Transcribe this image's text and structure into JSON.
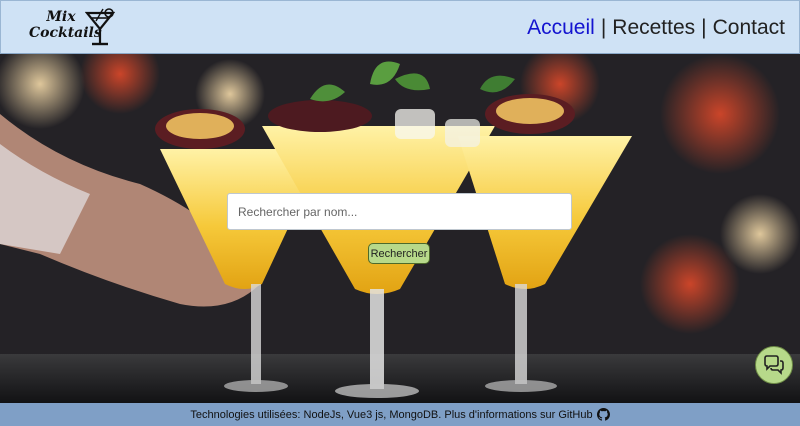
{
  "header": {
    "logo_line1": "Mix",
    "logo_line2": "Cocktails",
    "nav": {
      "home": "Accueil",
      "recipes": "Recettes",
      "contact": "Contact",
      "separator": "|"
    },
    "colors": {
      "background": "#cfe2f5",
      "active_link": "#1414d0",
      "link": "#222222"
    }
  },
  "search": {
    "placeholder": "Rechercher par nom...",
    "value": "",
    "button_label": "Rechercher",
    "button_color": "#b7d98a"
  },
  "chat": {
    "icon": "chat-bubbles-icon"
  },
  "footer": {
    "text": "Technologies utilisées: NodeJs, Vue3 js, MongoDB. Plus d'informations sur GitHub",
    "icon": "github-icon",
    "background": "#7f9fc6"
  },
  "hero": {
    "image": "cocktails-photo"
  }
}
